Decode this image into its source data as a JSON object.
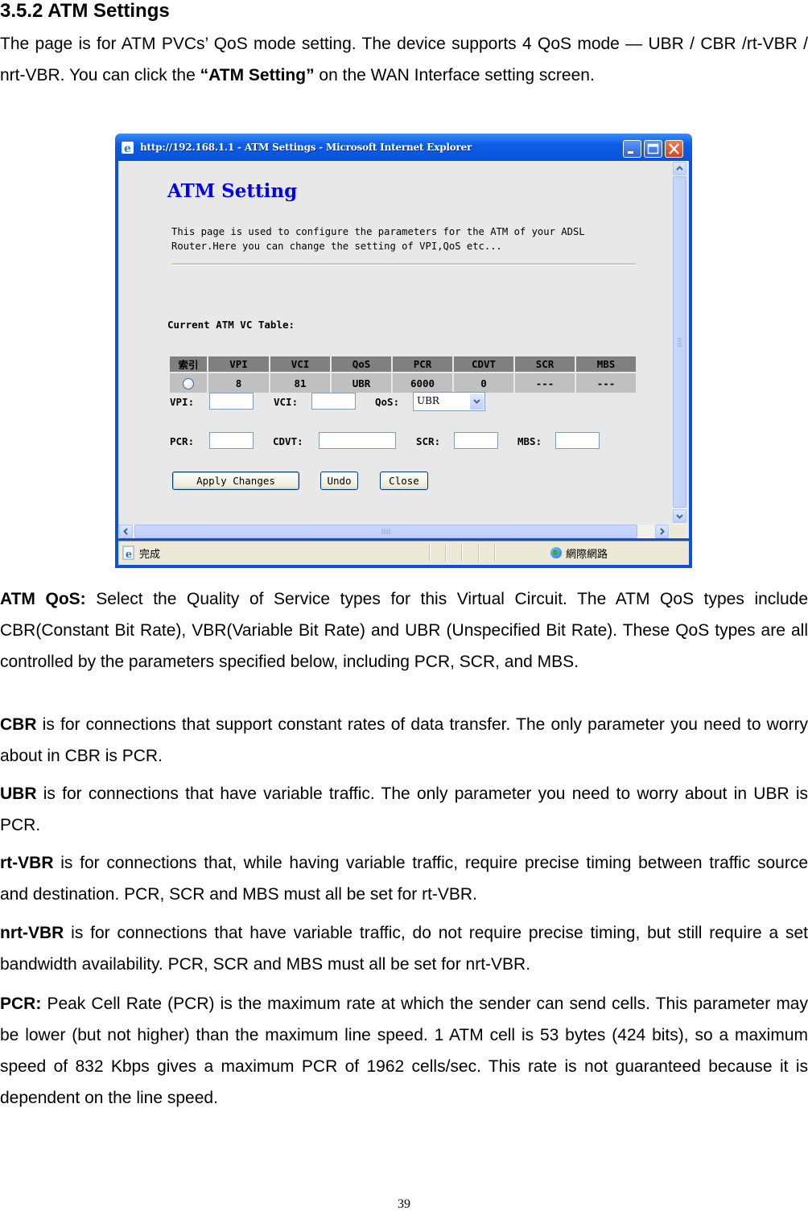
{
  "doc": {
    "heading": "3.5.2 ATM Settings",
    "intro": {
      "text1": "The page is for ATM PVCs’ QoS mode setting. The device supports 4 QoS mode — UBR / CBR /rt-VBR / nrt-VBR. You can click the ",
      "bold": "“ATM Setting”",
      "text2": " on the WAN Interface setting screen."
    },
    "paragraphs": [
      {
        "bold": "ATM QoS:",
        "text": " Select the Quality of Service types for this Virtual Circuit. The ATM QoS types include CBR(Constant Bit Rate), VBR(Variable Bit Rate) and UBR (Unspecified Bit Rate). These QoS types are all controlled by the parameters specified below, including PCR, SCR, and MBS."
      },
      {
        "bold": "CBR",
        "text": " is for connections that support constant rates of data transfer. The only parameter you need to worry about in CBR is PCR."
      },
      {
        "bold": "UBR",
        "text": " is for connections that have variable traffic. The only parameter you need to worry about in UBR is PCR."
      },
      {
        "bold": "rt-VBR",
        "text": " is for connections that, while having variable traffic, require precise timing between traffic source and destination. PCR, SCR and MBS must all be set for rt-VBR."
      },
      {
        "bold": "nrt-VBR",
        "text": " is for connections that have variable traffic, do not require precise timing, but still require a set bandwidth availability. PCR, SCR and MBS must all be set for nrt-VBR."
      },
      {
        "bold": "PCR:",
        "text": " Peak Cell Rate (PCR) is the maximum rate at which the sender can send cells. This parameter may be lower (but not higher) than the maximum line speed. 1 ATM cell is 53 bytes (424 bits), so a maximum speed of 832 Kbps gives a maximum PCR of 1962 cells/sec. This rate is not guaranteed because it is dependent on the line speed."
      }
    ],
    "page_number": "39"
  },
  "browser": {
    "title": "http://192.168.1.1 - ATM Settings - Microsoft Internet Explorer",
    "page_title": "ATM Setting",
    "description": "This page is used to configure the parameters for the ATM of your ADSL Router.Here you can change the setting of VPI,QoS etc...",
    "table_title": "Current ATM VC Table:",
    "table": {
      "headers": [
        "索引",
        "VPI",
        "VCI",
        "QoS",
        "PCR",
        "CDVT",
        "SCR",
        "MBS"
      ],
      "rows": [
        {
          "vpi": "8",
          "vci": "81",
          "qos": "UBR",
          "pcr": "6000",
          "cdvt": "0",
          "scr": "---",
          "mbs": "---"
        }
      ]
    },
    "form": {
      "vpi_label": "VPI:",
      "vci_label": "VCI:",
      "qos_label": "QoS:",
      "qos_value": "UBR",
      "pcr_label": "PCR:",
      "cdvt_label": "CDVT:",
      "scr_label": "SCR:",
      "mbs_label": "MBS:",
      "vpi_value": "",
      "vci_value": "",
      "pcr_value": "",
      "cdvt_value": "",
      "scr_value": "",
      "mbs_value": ""
    },
    "buttons": {
      "apply": "Apply Changes",
      "undo": "Undo",
      "close": "Close"
    },
    "status": {
      "text": "完成",
      "zone": "網際網路"
    },
    "colors": {
      "titlebar": "#0a5be0",
      "page_title": "#0000ee",
      "table_header": "#808080",
      "table_cell": "#c0c0c0",
      "content_bg": "#e8e8e8"
    }
  }
}
